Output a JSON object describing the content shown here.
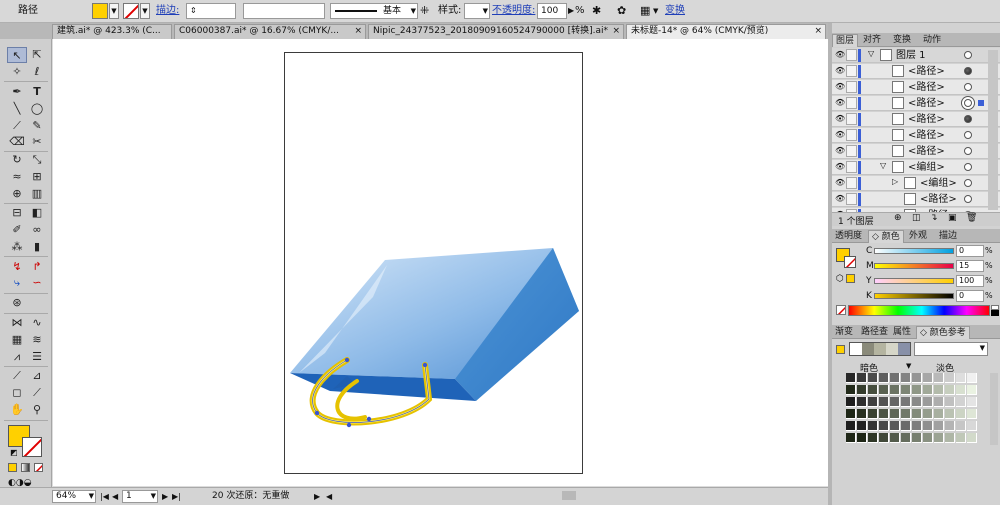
{
  "control_bar": {
    "object_type": "路径",
    "fill_color": "#ffd000",
    "stroke_label": "描边:",
    "stroke_weight": "",
    "variable_width": "",
    "brush_label": "基本",
    "style_label": "样式:",
    "opacity_label": "不透明度:",
    "opacity_value": "100",
    "opacity_unit": "%",
    "transform_link": "变换"
  },
  "doc_tabs": [
    {
      "label": "建筑.ai* @ 423.3% (C...",
      "active": false
    },
    {
      "label": "C06000387.ai* @ 16.67% (CMYK/...",
      "active": false
    },
    {
      "label": "Nipic_24377523_20180909160524790000 [转换].ai*",
      "active": false
    },
    {
      "label": "未标题-14* @ 64% (CMYK/预览)",
      "active": true
    }
  ],
  "status_bar": {
    "zoom": "64%",
    "artboard": "1",
    "status_text": "20 次还原：无重做"
  },
  "layers_panel": {
    "tabs": [
      "图层",
      "对齐",
      "变换",
      "动作"
    ],
    "rows": [
      {
        "name": "图层 1",
        "indent": 0,
        "top": true,
        "target": "hollow"
      },
      {
        "name": "<路径>",
        "indent": 1,
        "target": "filled"
      },
      {
        "name": "<路径>",
        "indent": 1,
        "target": "hollow"
      },
      {
        "name": "<路径>",
        "indent": 1,
        "target": "double"
      },
      {
        "name": "<路径>",
        "indent": 1,
        "target": "filled"
      },
      {
        "name": "<路径>",
        "indent": 1,
        "target": "hollow"
      },
      {
        "name": "<路径>",
        "indent": 1,
        "target": "hollow"
      },
      {
        "name": "<编组>",
        "indent": 1,
        "target": "hollow"
      },
      {
        "name": "<编组>",
        "indent": 2,
        "target": "hollow"
      },
      {
        "name": "<路径>",
        "indent": 2,
        "target": "hollow"
      },
      {
        "name": "<路径>",
        "indent": 2,
        "target": "hollow"
      }
    ],
    "footer_count": "1 个图层"
  },
  "color_panel": {
    "tabs": [
      "透明度",
      "颜色",
      "外观",
      "描边"
    ],
    "channels": [
      {
        "label": "C",
        "value": "0",
        "from": "#ffffff",
        "to": "#00a0e0"
      },
      {
        "label": "M",
        "value": "15",
        "from": "#ffff00",
        "to": "#e8004a"
      },
      {
        "label": "Y",
        "value": "100",
        "from": "#ffd0ff",
        "to": "#ffd000"
      },
      {
        "label": "K",
        "value": "0",
        "from": "#ffd000",
        "to": "#000000"
      }
    ],
    "pct": "%"
  },
  "swatch_panel": {
    "tabs": [
      "渐变",
      "路径查",
      "属性",
      "颜色参考"
    ],
    "dark_label": "暗色",
    "light_label": "淡色"
  }
}
